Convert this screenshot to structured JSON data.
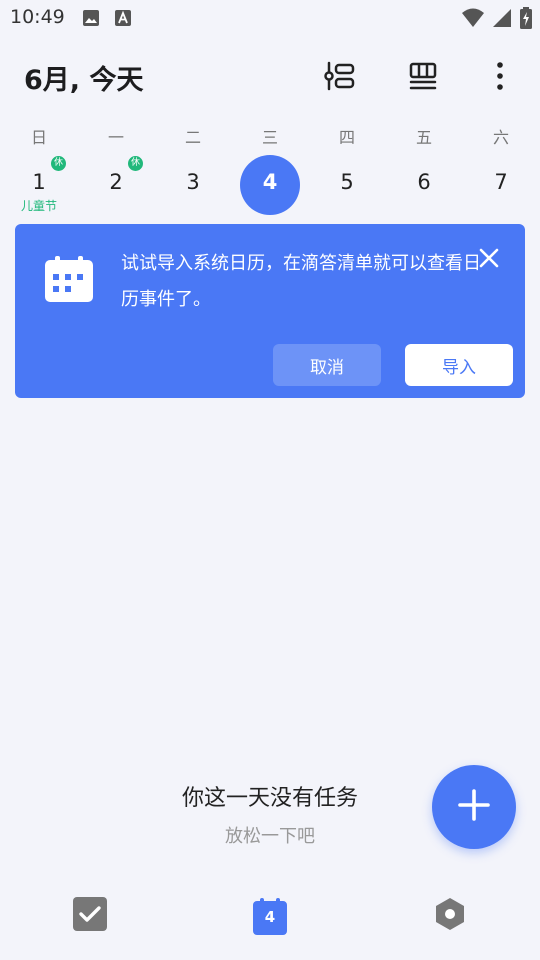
{
  "status_bar": {
    "time": "10:49",
    "icons": [
      "image-icon",
      "font-icon",
      "wifi-icon",
      "cellular-icon",
      "battery-charging-icon"
    ]
  },
  "header": {
    "title": "6月, 今天",
    "actions": [
      "filter-icon",
      "view-mode-icon",
      "more-vertical-icon"
    ]
  },
  "week": {
    "weekdays": [
      "日",
      "一",
      "二",
      "三",
      "四",
      "五",
      "六"
    ],
    "dates": [
      {
        "num": "1",
        "badge": "休",
        "festival": "儿童节",
        "selected": false
      },
      {
        "num": "2",
        "badge": "休",
        "festival": "",
        "selected": false
      },
      {
        "num": "3",
        "badge": "",
        "festival": "",
        "selected": false
      },
      {
        "num": "4",
        "badge": "",
        "festival": "",
        "selected": true
      },
      {
        "num": "5",
        "badge": "",
        "festival": "",
        "selected": false
      },
      {
        "num": "6",
        "badge": "",
        "festival": "",
        "selected": false
      },
      {
        "num": "7",
        "badge": "",
        "festival": "",
        "selected": false
      }
    ]
  },
  "banner": {
    "text": "试试导入系统日历，在滴答清单就可以查看日历事件了。",
    "cancel_label": "取消",
    "import_label": "导入"
  },
  "empty_state": {
    "title": "你这一天没有任务",
    "subtitle": "放松一下吧"
  },
  "bottom_nav": {
    "calendar_number": "4",
    "items": [
      "tasks-icon",
      "calendar-icon",
      "settings-icon"
    ]
  },
  "colors": {
    "accent": "#4a78f5",
    "holiday": "#21b87b",
    "background": "#f3f4fa"
  }
}
